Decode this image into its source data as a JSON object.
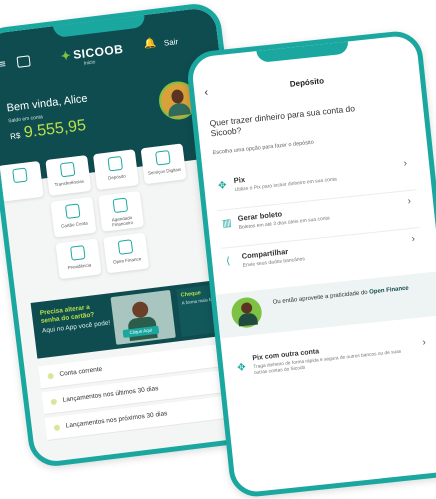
{
  "left_screen": {
    "header": {
      "brand": "SICOOB",
      "brand_sub": "Inicio",
      "exit_label": "Sair"
    },
    "greeting": "Bem vinda, Alice",
    "balance_label": "Saldo em conta",
    "currency": "R$",
    "balance": "9.555,95",
    "tiles": [
      "",
      "Transferências",
      "Depósito",
      "Serviços Digitais",
      "Cartão Conta",
      "Agendado Financeiro",
      "Previdência",
      "Open Finance"
    ],
    "promo": {
      "title": "Precisa alterar a senha do cartão?",
      "subtitle": "Aqui no App você pode!",
      "button": "Clique Aqui",
      "side_title": "Cheque",
      "side_text": "A forma mais fácil de ..."
    },
    "rows": [
      "Conta corrente",
      "Lançamentos nos últimos 30 dias",
      "Lançamentos nos próximos 30 dias"
    ]
  },
  "right_screen": {
    "title": "Depósito",
    "question": "Quer trazer dinheiro para sua conta do Sicoob?",
    "hint": "Escolha uma opção para fazer o depósito",
    "options": [
      {
        "title": "Pix",
        "desc": "Utilize o Pix para incluir dinheiro em sua conta"
      },
      {
        "title": "Gerar boleto",
        "desc": "Boletos em até 3 dias úteis em sua conta"
      },
      {
        "title": "Compartilhar",
        "desc": "Envie seus dados bancários"
      }
    ],
    "open_finance": {
      "text": "Ou então aproveite a praticidade do",
      "highlight": "Open Finance"
    },
    "pix_other": {
      "title": "Pix com outra conta",
      "desc": "Traga dinheiro de forma rápida e segura de outros bancos ou de suas outras contas do Sicoob"
    }
  }
}
